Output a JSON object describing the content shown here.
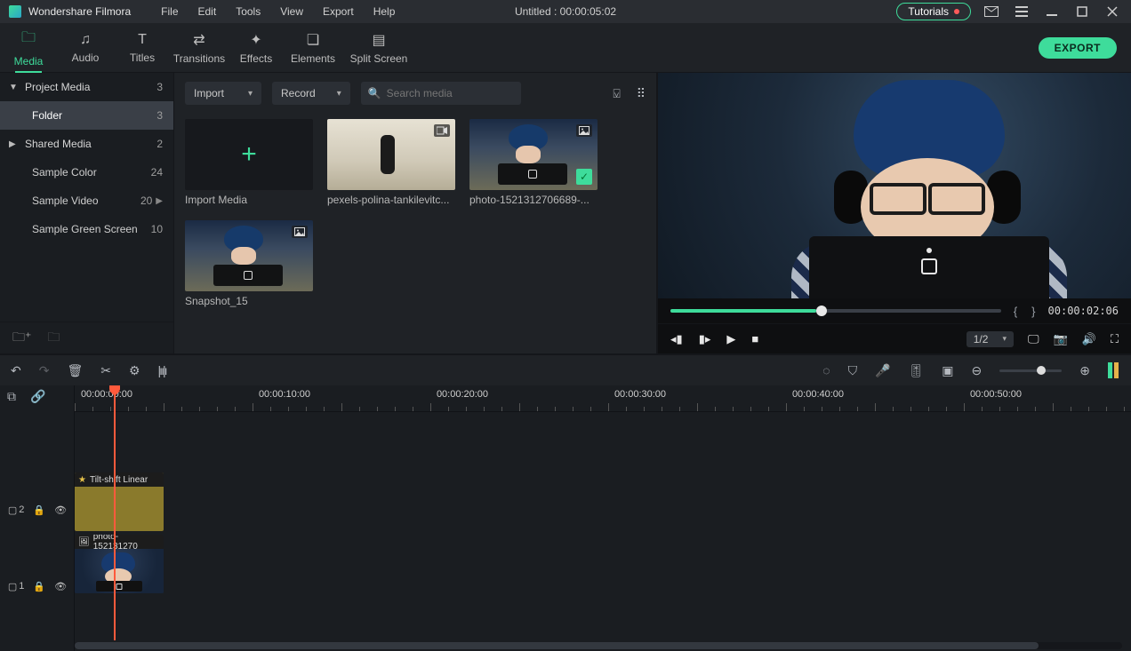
{
  "app": {
    "name": "Wondershare Filmora"
  },
  "menu": [
    "File",
    "Edit",
    "Tools",
    "View",
    "Export",
    "Help"
  ],
  "title_center": "Untitled : 00:00:05:02",
  "tutorials": "Tutorials",
  "tabs": [
    {
      "label": "Media",
      "active": true
    },
    {
      "label": "Audio"
    },
    {
      "label": "Titles"
    },
    {
      "label": "Transitions"
    },
    {
      "label": "Effects"
    },
    {
      "label": "Elements"
    },
    {
      "label": "Split Screen"
    }
  ],
  "export_btn": "EXPORT",
  "sidebar": {
    "items": [
      {
        "label": "Project Media",
        "count": "3",
        "arrow": "▼"
      },
      {
        "label": "Folder",
        "count": "3",
        "selected": true,
        "indent": true
      },
      {
        "label": "Shared Media",
        "count": "2",
        "arrow": "▶"
      },
      {
        "label": "Sample Color",
        "count": "24",
        "indent": true
      },
      {
        "label": "Sample Video",
        "count": "20",
        "indent": true,
        "chev": true
      },
      {
        "label": "Sample Green Screen",
        "count": "10",
        "indent": true
      }
    ]
  },
  "media_toolbar": {
    "import": "Import",
    "record": "Record",
    "search_placeholder": "Search media"
  },
  "media_items": [
    {
      "label": "Import Media",
      "type": "import"
    },
    {
      "label": "pexels-polina-tankilevitc...",
      "type": "video",
      "art": "art1"
    },
    {
      "label": "photo-1521312706689-...",
      "type": "image",
      "art": "art2",
      "selected": true
    },
    {
      "label": "Snapshot_15",
      "type": "image",
      "art": "art2"
    }
  ],
  "preview": {
    "timecode": "00:00:02:06",
    "quality": "1/2"
  },
  "timeline": {
    "ruler": [
      "00:00:00:00",
      "00:00:10:00",
      "00:00:20:00",
      "00:00:30:00",
      "00:00:40:00",
      "00:00:50:00"
    ],
    "tracks": [
      {
        "id": "2",
        "kind": "video"
      },
      {
        "id": "1",
        "kind": "video"
      }
    ],
    "clips": {
      "fx_label": "Tilt-shift Linear",
      "vid_label": "photo-152131270"
    }
  }
}
